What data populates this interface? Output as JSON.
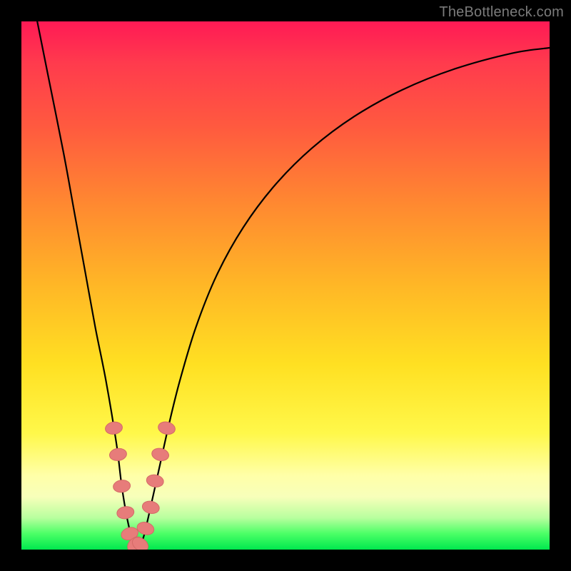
{
  "watermark": "TheBottleneck.com",
  "colors": {
    "frame": "#000000",
    "curve": "#000000",
    "marker_fill": "#e77c7a",
    "marker_stroke": "#d46a67",
    "gradient_stops": [
      "#ff1a55",
      "#ff5a3f",
      "#ffb726",
      "#fff84a",
      "#ffffa8",
      "#00e84e"
    ]
  },
  "chart_data": {
    "type": "line",
    "title": "",
    "xlabel": "",
    "ylabel": "",
    "xlim": [
      0,
      100
    ],
    "ylim": [
      0,
      100
    ],
    "grid": false,
    "series": [
      {
        "name": "bottleneck-curve",
        "x": [
          3,
          5,
          8,
          10,
          12,
          14,
          16,
          18,
          19,
          20,
          21,
          22,
          23,
          24,
          26,
          28,
          30,
          33,
          37,
          42,
          48,
          55,
          63,
          72,
          82,
          93,
          100
        ],
        "y": [
          100,
          90,
          75,
          64,
          53,
          42,
          32,
          20,
          12,
          6,
          2,
          0.5,
          2,
          6,
          15,
          24,
          32,
          42,
          52,
          61,
          69,
          76,
          82,
          87,
          91,
          94,
          95
        ]
      }
    ],
    "markers": {
      "name": "highlighted-points",
      "x": [
        17.5,
        18.3,
        19.0,
        19.7,
        20.5,
        21.5,
        22.5,
        23.5,
        24.5,
        25.3,
        26.3,
        27.5
      ],
      "y": [
        23,
        18,
        12,
        7,
        3,
        1,
        1,
        4,
        8,
        13,
        18,
        23
      ]
    },
    "annotations": [
      {
        "text": "TheBottleneck.com",
        "position": "top-right"
      }
    ]
  }
}
